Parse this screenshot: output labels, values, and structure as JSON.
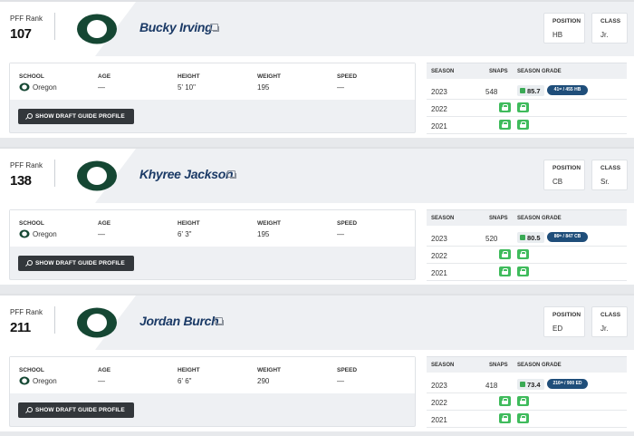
{
  "labels": {
    "pff_rank": "PFF Rank",
    "position": "POSITION",
    "class": "CLASS",
    "school": "SCHOOL",
    "age": "AGE",
    "height": "HEIGHT",
    "weight": "WEIGHT",
    "speed": "SPEED",
    "button": "SHOW DRAFT GUIDE PROFILE",
    "season": "SEASON",
    "snaps": "SNAPS",
    "season_grade": "SEASON GRADE"
  },
  "colors": {
    "oregon_green": "#154733",
    "grade_green": "#3aaa55",
    "lock_green": "#3fbb5c",
    "name_blue": "#1b3a66",
    "rank_pill": "#1f4e7a"
  },
  "icons": {
    "logo": "oregon-o-logo",
    "compare": "compare-icon",
    "search": "search-icon",
    "lock": "lock-icon"
  },
  "players": [
    {
      "rank": "107",
      "name": "Bucky Irving",
      "position": "HB",
      "class": "Jr.",
      "school": "Oregon",
      "age": "—",
      "height": "5' 10\"",
      "weight": "195",
      "speed": "—",
      "seasons": [
        {
          "year": "2023",
          "snaps": "548",
          "grade": "85.7",
          "rank_text": "41ˢᵗ / 455 HB"
        },
        {
          "year": "2022",
          "locked": true
        },
        {
          "year": "2021",
          "locked": true
        }
      ]
    },
    {
      "rank": "138",
      "name": "Khyree Jackson",
      "position": "CB",
      "class": "Sr.",
      "school": "Oregon",
      "age": "—",
      "height": "6' 3\"",
      "weight": "195",
      "speed": "—",
      "seasons": [
        {
          "year": "2023",
          "snaps": "520",
          "grade": "80.5",
          "rank_text": "86ᵗʰ / 847 CB"
        },
        {
          "year": "2022",
          "locked": true
        },
        {
          "year": "2021",
          "locked": true
        }
      ]
    },
    {
      "rank": "211",
      "name": "Jordan Burch",
      "position": "ED",
      "class": "Jr.",
      "school": "Oregon",
      "age": "—",
      "height": "6' 6\"",
      "weight": "290",
      "speed": "—",
      "seasons": [
        {
          "year": "2023",
          "snaps": "418",
          "grade": "73.4",
          "rank_text": "216ᵗʰ / 900 ED"
        },
        {
          "year": "2022",
          "locked": true
        },
        {
          "year": "2021",
          "locked": true
        }
      ]
    }
  ]
}
